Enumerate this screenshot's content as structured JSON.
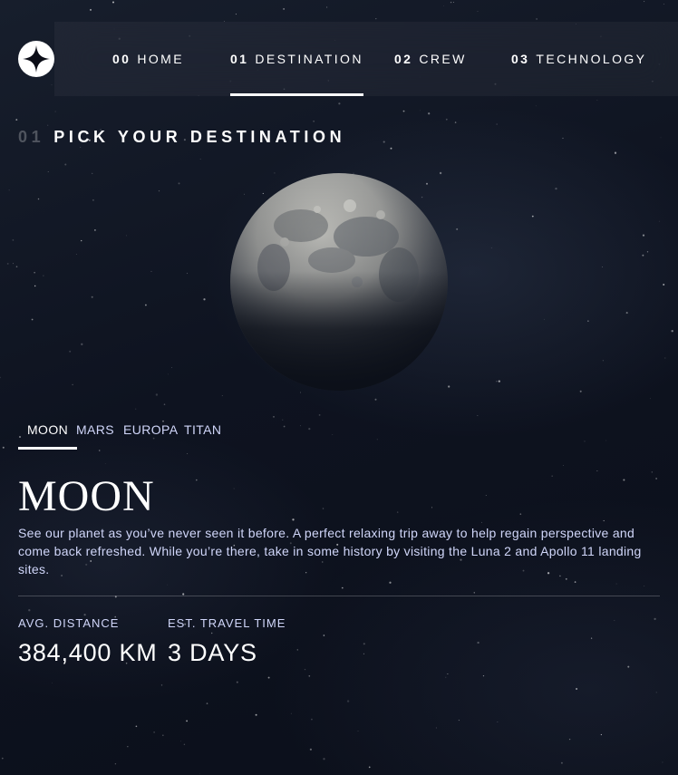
{
  "header": {
    "logo_icon": "star-logo-icon",
    "nav": [
      {
        "number": "00",
        "label": "HOME",
        "active": false
      },
      {
        "number": "01",
        "label": "DESTINATION",
        "active": true
      },
      {
        "number": "02",
        "label": "CREW",
        "active": false
      },
      {
        "number": "03",
        "label": "TECHNOLOGY",
        "active": false
      }
    ]
  },
  "page": {
    "heading_number": "01",
    "heading_text": "PICK YOUR DESTINATION"
  },
  "destination": {
    "image": "moon-planet-image",
    "tabs": [
      {
        "label": "MOON",
        "active": true
      },
      {
        "label": "MARS",
        "active": false
      },
      {
        "label": "EUROPA",
        "active": false
      },
      {
        "label": "TITAN",
        "active": false
      }
    ],
    "name": "MOON",
    "description": "See our planet as you’ve never seen it before. A perfect relaxing trip away to help regain perspective and come back refreshed. While you’re there, take in some history by visiting the Luna 2 and Apollo 11 landing sites.",
    "stats": {
      "distance_label": "AVG. DISTANCE",
      "distance_value": "384,400 KM",
      "travel_label": "EST. TRAVEL TIME",
      "travel_value": "3 DAYS"
    }
  },
  "colors": {
    "background": "#0b0d17",
    "text_primary": "#ffffff",
    "text_secondary": "#d0d6f9"
  }
}
